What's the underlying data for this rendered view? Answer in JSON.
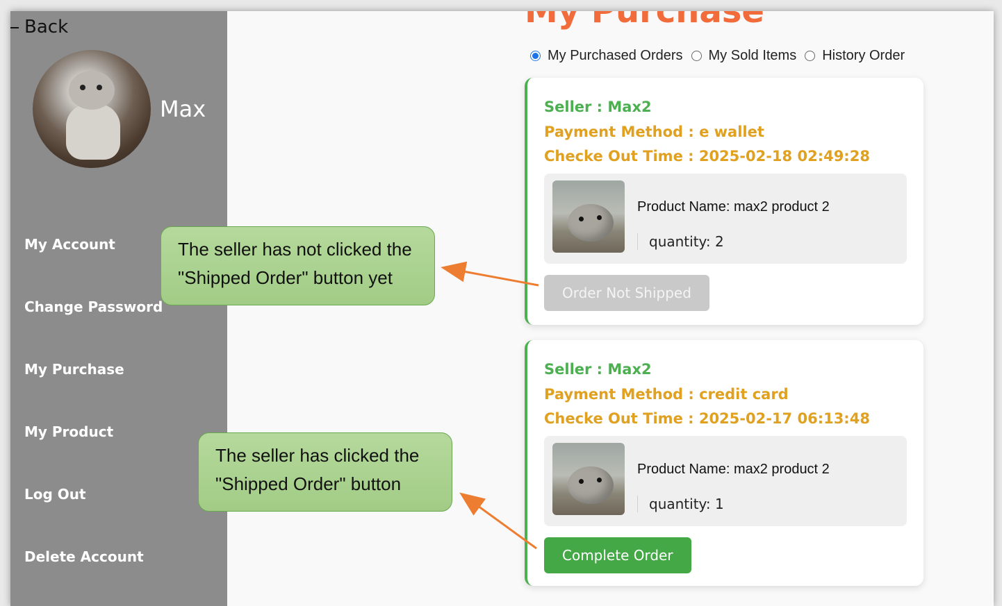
{
  "sidebar": {
    "back_label": "Back",
    "username": "Max",
    "items": [
      {
        "label": "My Account"
      },
      {
        "label": "Change Password"
      },
      {
        "label": "My Purchase"
      },
      {
        "label": "My Product"
      },
      {
        "label": "Log Out"
      },
      {
        "label": "Delete Account"
      }
    ]
  },
  "main": {
    "title": "My Purchase",
    "filters": [
      {
        "label": "My Purchased Orders",
        "selected": true
      },
      {
        "label": "My Sold Items",
        "selected": false
      },
      {
        "label": "History Order",
        "selected": false
      }
    ],
    "orders": [
      {
        "seller": "Seller : Max2",
        "payment": "Payment Method : e wallet",
        "checkout": "Checke Out Time : 2025-02-18 02:49:28",
        "product_name": "Product Name: max2 product 2",
        "quantity": "quantity: 2",
        "button_label": "Order Not Shipped"
      },
      {
        "seller": "Seller : Max2",
        "payment": "Payment Method : credit card",
        "checkout": "Checke Out Time : 2025-02-17 06:13:48",
        "product_name": "Product Name: max2 product 2",
        "quantity": "quantity: 1",
        "button_label": "Complete Order"
      }
    ]
  },
  "annotations": {
    "not_shipped_line1": "The seller has not clicked the",
    "not_shipped_line2": "\"Shipped Order\" button yet",
    "shipped_line1": "The seller has clicked the",
    "shipped_line2": "\"Shipped Order\" button"
  },
  "colors": {
    "sidebar_bg": "#8c8c8c",
    "title": "#f26b3a",
    "seller": "#4caf50",
    "payment": "#e0a020",
    "complete_button": "#43a845",
    "disabled_button": "#c9c9c9",
    "arrow": "#ed7d31",
    "callout": "#a8d08d"
  }
}
